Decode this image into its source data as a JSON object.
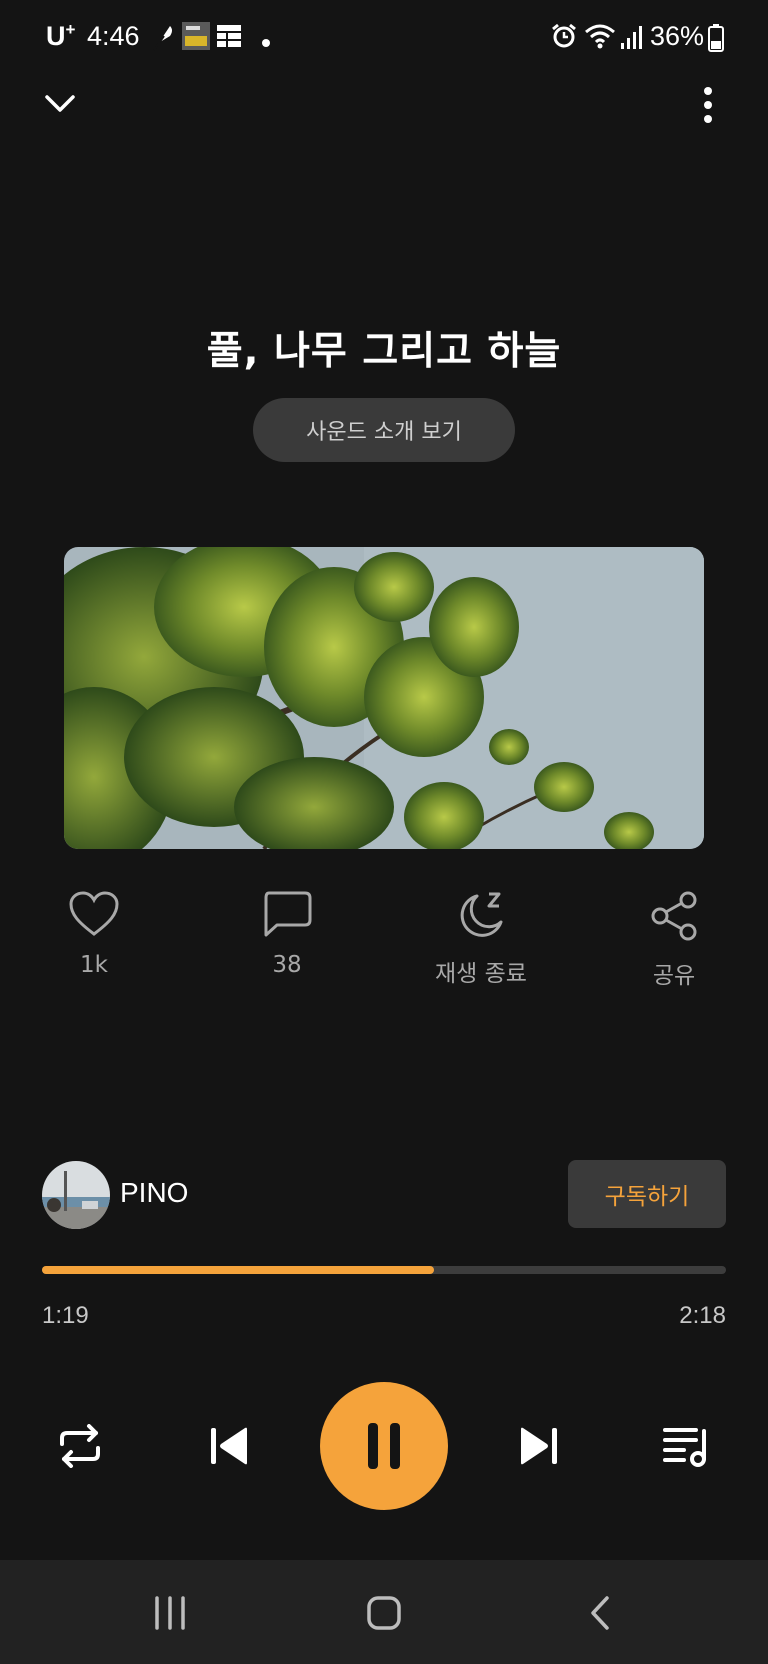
{
  "status_bar": {
    "carrier": "U",
    "carrier_sup": "+",
    "time": "4:46",
    "battery_percent": "36%",
    "icons": [
      "feather-notif-icon",
      "smart-emile-notif-icon",
      "grid-notif-icon",
      "dot-icon",
      "alarm-icon",
      "wifi-icon",
      "signal-icon",
      "battery-icon"
    ]
  },
  "header": {
    "collapse_icon": "chevron-down-icon",
    "more_icon": "more-vertical-icon"
  },
  "track": {
    "title": "풀, 나무 그리고 하늘",
    "intro_button_label": "사운드 소개 보기"
  },
  "actions": {
    "like": {
      "icon": "heart-icon",
      "label": "1k"
    },
    "comment": {
      "icon": "comment-icon",
      "label": "38"
    },
    "sleep": {
      "icon": "sleep-moon-icon",
      "label": "재생 종료"
    },
    "share": {
      "icon": "share-icon",
      "label": "공유"
    }
  },
  "creator": {
    "name": "PINO",
    "subscribe_label": "구독하기"
  },
  "progress": {
    "current": "1:19",
    "total": "2:18",
    "fraction": 0.573
  },
  "controls": {
    "icons": [
      "repeat-icon",
      "previous-icon",
      "pause-icon",
      "next-icon",
      "playlist-icon"
    ]
  },
  "nav": {
    "icons": [
      "recent-apps-icon",
      "home-icon",
      "back-icon"
    ]
  },
  "colors": {
    "background": "#141414",
    "accent": "#f5a33b",
    "button_bg": "#3a3a3a",
    "nav_bg": "#222222"
  }
}
